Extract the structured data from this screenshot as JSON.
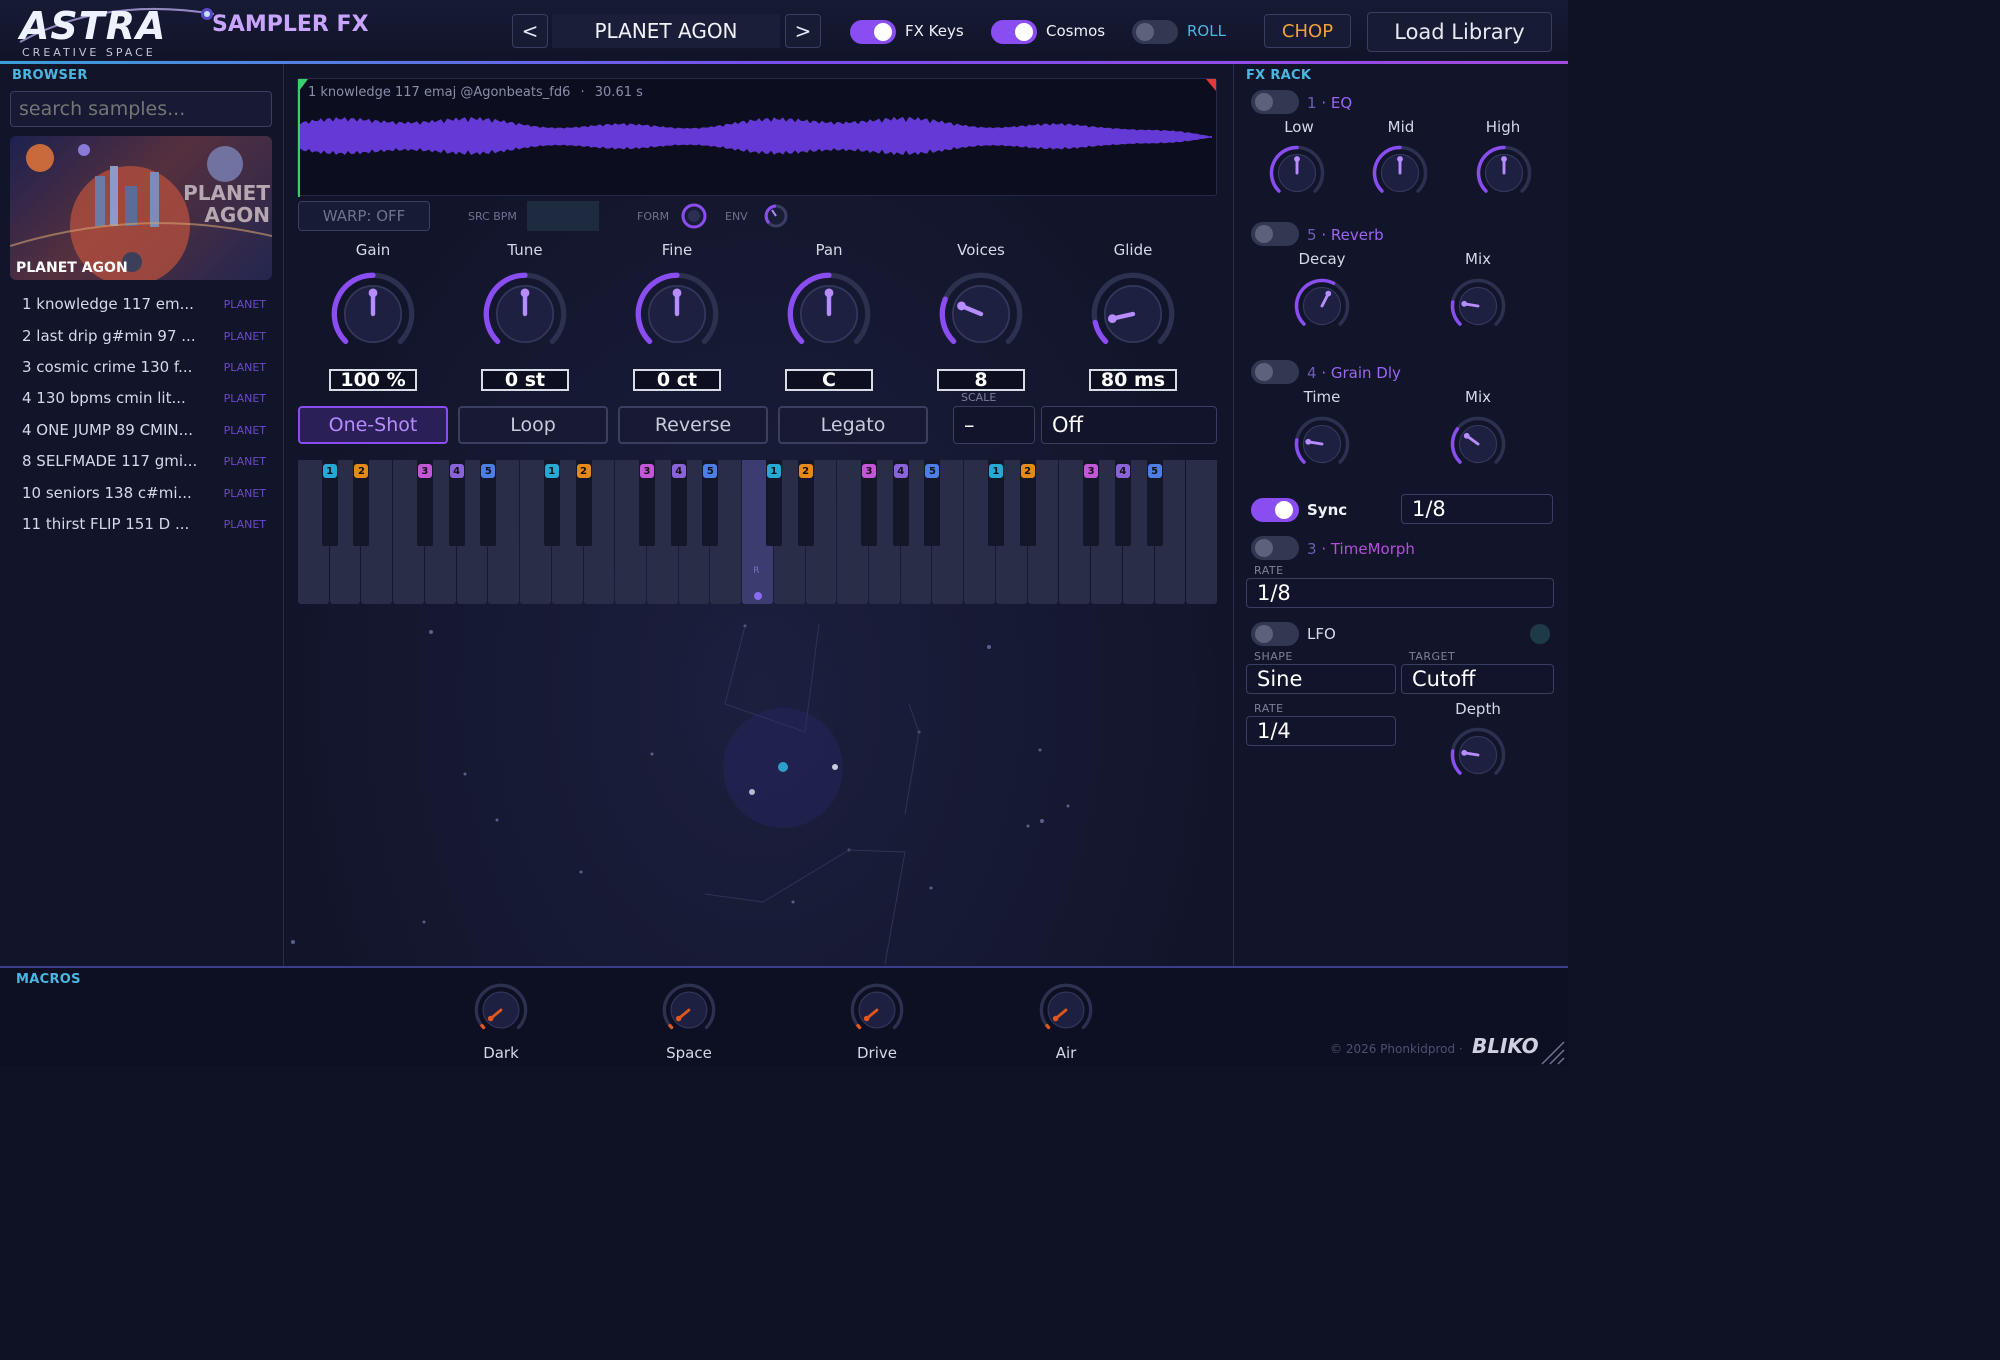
{
  "header": {
    "logo_text": "ASTRA",
    "logo_sub": "CREATIVE SPACE",
    "app_name": "SAMPLER FX",
    "prev_label": "<",
    "next_label": ">",
    "preset_name": "PLANET AGON",
    "toggles": [
      {
        "label": "FX Keys",
        "on": true
      },
      {
        "label": "Cosmos",
        "on": true
      },
      {
        "label": "ROLL",
        "on": false
      }
    ],
    "chop_label": "CHOP",
    "load_label": "Load Library"
  },
  "browser": {
    "title": "BROWSER",
    "search_placeholder": "search samples...",
    "cover_title": "PLANET AGON",
    "cover_art_text": "PLANET AGON",
    "items": [
      {
        "name": "1 knowledge 117 em...",
        "tag": "PLANET"
      },
      {
        "name": "2 last drip g#min 97 ...",
        "tag": "PLANET"
      },
      {
        "name": "3 cosmic crime 130 f...",
        "tag": "PLANET"
      },
      {
        "name": "4  130 bpms cmin lit...",
        "tag": "PLANET"
      },
      {
        "name": "4 ONE JUMP 89 CMIN...",
        "tag": "PLANET"
      },
      {
        "name": "8 SELFMADE 117 gmi...",
        "tag": "PLANET"
      },
      {
        "name": "10 seniors 138 c#mi...",
        "tag": "PLANET"
      },
      {
        "name": "11 thirst FLIP  151 D ...",
        "tag": "PLANET"
      }
    ]
  },
  "waveform": {
    "file_label": "1 knowledge 117 emaj @Agonbeats_fd6",
    "separator": "·",
    "duration": "30.61 s"
  },
  "warp": {
    "label": "WARP: OFF",
    "src_bpm_label": "SRC BPM",
    "src_bpm_value": "",
    "form_label": "FORM",
    "env_label": "ENV"
  },
  "knobs": [
    {
      "label": "Gain",
      "value": "100 %",
      "level": 0.5
    },
    {
      "label": "Tune",
      "value": "0 st",
      "level": 0.5
    },
    {
      "label": "Fine",
      "value": "0 ct",
      "level": 0.5
    },
    {
      "label": "Pan",
      "value": "C",
      "level": 0.5
    },
    {
      "label": "Voices",
      "value": "8",
      "level": 0.25
    },
    {
      "label": "Glide",
      "value": "80 ms",
      "level": 0.12
    }
  ],
  "modes": {
    "buttons": [
      {
        "label": "One-Shot",
        "active": true
      },
      {
        "label": "Loop",
        "active": false
      },
      {
        "label": "Reverse",
        "active": false
      },
      {
        "label": "Legato",
        "active": false
      }
    ],
    "scale_label": "SCALE",
    "scale_value": "–",
    "scale_mode": "Off"
  },
  "keyboard": {
    "slot_numbers": [
      "1",
      "2",
      "3",
      "4",
      "5"
    ],
    "root_key_label": "R",
    "slot_colors": [
      "#27a9d6",
      "#e38a17",
      "#c456d8",
      "#8b63d9",
      "#4d7ee6"
    ]
  },
  "fx_rack": {
    "title": "FX RACK",
    "eq": {
      "num": "1",
      "name": "EQ",
      "on": false,
      "knobs": [
        {
          "label": "Low"
        },
        {
          "label": "Mid"
        },
        {
          "label": "High"
        }
      ]
    },
    "reverb": {
      "num": "5",
      "name": "Reverb",
      "on": false,
      "knobs": [
        {
          "label": "Decay"
        },
        {
          "label": "Mix"
        }
      ]
    },
    "grain": {
      "num": "4",
      "name": "Grain Dly",
      "on": false,
      "knobs": [
        {
          "label": "Time"
        },
        {
          "label": "Mix"
        }
      ]
    },
    "sync": {
      "label": "Sync",
      "on": true,
      "value": "1/8"
    },
    "timemorph": {
      "num": "3",
      "name": "TimeMorph",
      "on": false,
      "rate_label": "RATE",
      "rate_value": "1/8"
    },
    "lfo": {
      "label": "LFO",
      "on": false,
      "shape_label": "SHAPE",
      "shape_value": "Sine",
      "target_label": "TARGET",
      "target_value": "Cutoff",
      "rate_label": "RATE",
      "rate_value": "1/4",
      "depth_label": "Depth"
    }
  },
  "macros": {
    "title": "MACROS",
    "items": [
      {
        "label": "Dark"
      },
      {
        "label": "Space"
      },
      {
        "label": "Drive"
      },
      {
        "label": "Air"
      }
    ],
    "copyright": "© 2026 Phonkidprod ·",
    "brand": "BLIKO"
  },
  "colors": {
    "accent": "#8a4df2",
    "cyan": "#4ab7e2",
    "macro_orange": "#e0561c",
    "chop_orange": "#f0a23a"
  }
}
